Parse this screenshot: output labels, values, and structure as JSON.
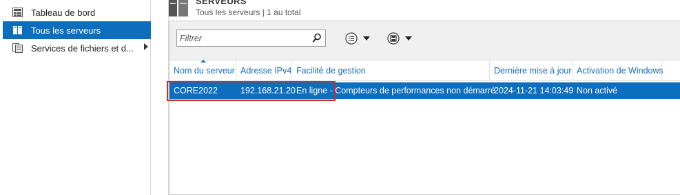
{
  "sidebar": {
    "items": [
      {
        "label": "Tableau de bord",
        "icon": "dashboard-icon",
        "selected": false
      },
      {
        "label": "Tous les serveurs",
        "icon": "servers-icon",
        "selected": true
      },
      {
        "label": "Services de fichiers et d...",
        "icon": "file-services-icon",
        "selected": false,
        "has_submenu": true
      }
    ]
  },
  "header": {
    "title": "SERVEURS",
    "subtitle": "Tous les serveurs | 1 au total"
  },
  "toolbar": {
    "filter_placeholder": "Filtrer",
    "search_icon": "search-icon",
    "list_view_icon": "list-options-icon",
    "save_icon": "save-query-icon"
  },
  "table": {
    "columns": [
      "Nom du serveur",
      "Adresse IPv4",
      "Facilité de gestion",
      "Dernière mise à jour",
      "Activation de Windows"
    ],
    "rows": [
      {
        "name": "CORE2022",
        "ipv4": "192.168.21.20",
        "manageability": "En ligne - Compteurs de performances non démarré",
        "last_update": "2024-11-21 14:03:49",
        "activation": "Non activé"
      }
    ]
  },
  "colors": {
    "selection": "#0e6ebe",
    "column_header_text": "#1a6bbf",
    "highlight_border": "#d42a2a"
  }
}
